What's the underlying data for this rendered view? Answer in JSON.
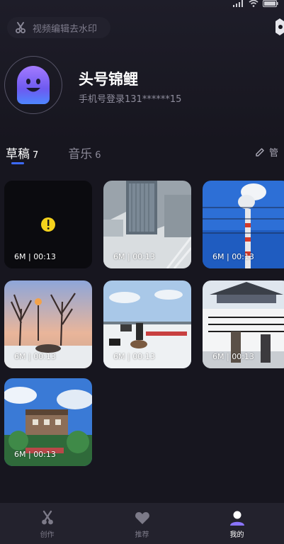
{
  "header": {
    "watermark_button_label": "视频编辑去水印"
  },
  "profile": {
    "username": "头号锦鲤",
    "login_info": "手机号登录131******15"
  },
  "tabs": [
    {
      "label": "草稿",
      "count": "7",
      "active": true
    },
    {
      "label": "音乐",
      "count": "6",
      "active": false
    }
  ],
  "manage_label": "管",
  "drafts": [
    {
      "meta": "6M | 00:13",
      "scene": "black-warning"
    },
    {
      "meta": "6M | 00:13",
      "scene": "snowy-skyscraper"
    },
    {
      "meta": "6M | 00:13",
      "scene": "chimney-sky"
    },
    {
      "meta": "6M | 00:13",
      "scene": "winter-trees-sunset"
    },
    {
      "meta": "6M | 00:13",
      "scene": "frozen-lake"
    },
    {
      "meta": "6M | 00:13",
      "scene": "courtyard-wall"
    },
    {
      "meta": "6M | 00:13",
      "scene": "hillside-house"
    }
  ],
  "bottom_nav": [
    {
      "label": "创作",
      "icon": "scissors-icon",
      "active": false
    },
    {
      "label": "推荐",
      "icon": "heart-icon",
      "active": false
    },
    {
      "label": "我的",
      "icon": "profile-icon",
      "active": true
    }
  ],
  "colors": {
    "background": "#17161f",
    "accent": "#3d6bff",
    "nav_background": "#23222d"
  }
}
